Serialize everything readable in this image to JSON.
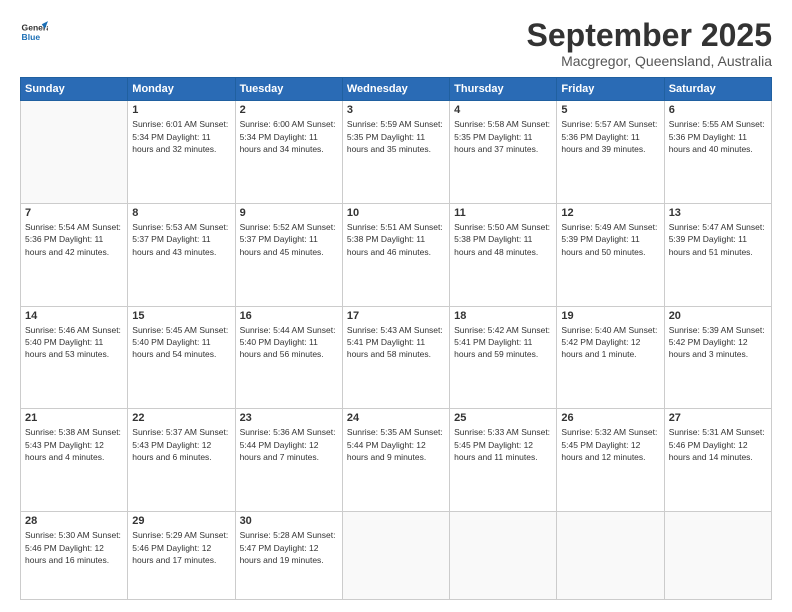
{
  "logo": {
    "line1": "General",
    "line2": "Blue"
  },
  "header": {
    "title": "September 2025",
    "subtitle": "Macgregor, Queensland, Australia"
  },
  "days_of_week": [
    "Sunday",
    "Monday",
    "Tuesday",
    "Wednesday",
    "Thursday",
    "Friday",
    "Saturday"
  ],
  "weeks": [
    [
      {
        "day": "",
        "info": ""
      },
      {
        "day": "1",
        "info": "Sunrise: 6:01 AM\nSunset: 5:34 PM\nDaylight: 11 hours\nand 32 minutes."
      },
      {
        "day": "2",
        "info": "Sunrise: 6:00 AM\nSunset: 5:34 PM\nDaylight: 11 hours\nand 34 minutes."
      },
      {
        "day": "3",
        "info": "Sunrise: 5:59 AM\nSunset: 5:35 PM\nDaylight: 11 hours\nand 35 minutes."
      },
      {
        "day": "4",
        "info": "Sunrise: 5:58 AM\nSunset: 5:35 PM\nDaylight: 11 hours\nand 37 minutes."
      },
      {
        "day": "5",
        "info": "Sunrise: 5:57 AM\nSunset: 5:36 PM\nDaylight: 11 hours\nand 39 minutes."
      },
      {
        "day": "6",
        "info": "Sunrise: 5:55 AM\nSunset: 5:36 PM\nDaylight: 11 hours\nand 40 minutes."
      }
    ],
    [
      {
        "day": "7",
        "info": "Sunrise: 5:54 AM\nSunset: 5:36 PM\nDaylight: 11 hours\nand 42 minutes."
      },
      {
        "day": "8",
        "info": "Sunrise: 5:53 AM\nSunset: 5:37 PM\nDaylight: 11 hours\nand 43 minutes."
      },
      {
        "day": "9",
        "info": "Sunrise: 5:52 AM\nSunset: 5:37 PM\nDaylight: 11 hours\nand 45 minutes."
      },
      {
        "day": "10",
        "info": "Sunrise: 5:51 AM\nSunset: 5:38 PM\nDaylight: 11 hours\nand 46 minutes."
      },
      {
        "day": "11",
        "info": "Sunrise: 5:50 AM\nSunset: 5:38 PM\nDaylight: 11 hours\nand 48 minutes."
      },
      {
        "day": "12",
        "info": "Sunrise: 5:49 AM\nSunset: 5:39 PM\nDaylight: 11 hours\nand 50 minutes."
      },
      {
        "day": "13",
        "info": "Sunrise: 5:47 AM\nSunset: 5:39 PM\nDaylight: 11 hours\nand 51 minutes."
      }
    ],
    [
      {
        "day": "14",
        "info": "Sunrise: 5:46 AM\nSunset: 5:40 PM\nDaylight: 11 hours\nand 53 minutes."
      },
      {
        "day": "15",
        "info": "Sunrise: 5:45 AM\nSunset: 5:40 PM\nDaylight: 11 hours\nand 54 minutes."
      },
      {
        "day": "16",
        "info": "Sunrise: 5:44 AM\nSunset: 5:40 PM\nDaylight: 11 hours\nand 56 minutes."
      },
      {
        "day": "17",
        "info": "Sunrise: 5:43 AM\nSunset: 5:41 PM\nDaylight: 11 hours\nand 58 minutes."
      },
      {
        "day": "18",
        "info": "Sunrise: 5:42 AM\nSunset: 5:41 PM\nDaylight: 11 hours\nand 59 minutes."
      },
      {
        "day": "19",
        "info": "Sunrise: 5:40 AM\nSunset: 5:42 PM\nDaylight: 12 hours\nand 1 minute."
      },
      {
        "day": "20",
        "info": "Sunrise: 5:39 AM\nSunset: 5:42 PM\nDaylight: 12 hours\nand 3 minutes."
      }
    ],
    [
      {
        "day": "21",
        "info": "Sunrise: 5:38 AM\nSunset: 5:43 PM\nDaylight: 12 hours\nand 4 minutes."
      },
      {
        "day": "22",
        "info": "Sunrise: 5:37 AM\nSunset: 5:43 PM\nDaylight: 12 hours\nand 6 minutes."
      },
      {
        "day": "23",
        "info": "Sunrise: 5:36 AM\nSunset: 5:44 PM\nDaylight: 12 hours\nand 7 minutes."
      },
      {
        "day": "24",
        "info": "Sunrise: 5:35 AM\nSunset: 5:44 PM\nDaylight: 12 hours\nand 9 minutes."
      },
      {
        "day": "25",
        "info": "Sunrise: 5:33 AM\nSunset: 5:45 PM\nDaylight: 12 hours\nand 11 minutes."
      },
      {
        "day": "26",
        "info": "Sunrise: 5:32 AM\nSunset: 5:45 PM\nDaylight: 12 hours\nand 12 minutes."
      },
      {
        "day": "27",
        "info": "Sunrise: 5:31 AM\nSunset: 5:46 PM\nDaylight: 12 hours\nand 14 minutes."
      }
    ],
    [
      {
        "day": "28",
        "info": "Sunrise: 5:30 AM\nSunset: 5:46 PM\nDaylight: 12 hours\nand 16 minutes."
      },
      {
        "day": "29",
        "info": "Sunrise: 5:29 AM\nSunset: 5:46 PM\nDaylight: 12 hours\nand 17 minutes."
      },
      {
        "day": "30",
        "info": "Sunrise: 5:28 AM\nSunset: 5:47 PM\nDaylight: 12 hours\nand 19 minutes."
      },
      {
        "day": "",
        "info": ""
      },
      {
        "day": "",
        "info": ""
      },
      {
        "day": "",
        "info": ""
      },
      {
        "day": "",
        "info": ""
      }
    ]
  ]
}
